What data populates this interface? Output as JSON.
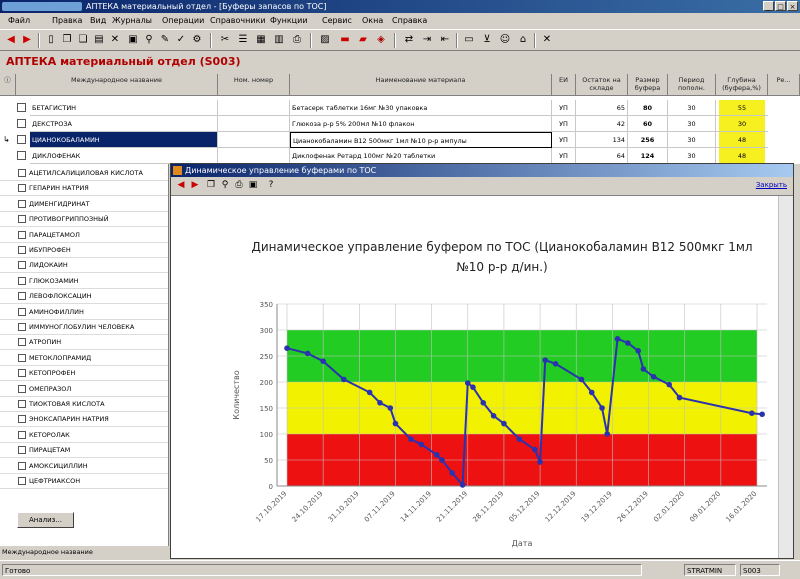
{
  "window": {
    "title": "АПТЕКА материальный отдел - [Буферы запасов по TOC]"
  },
  "menu": [
    "Файл",
    "Правка",
    "Вид",
    "Журналы",
    "Операции",
    "Справочники",
    "Функции",
    "Сервис",
    "Окна",
    "Справка"
  ],
  "header": {
    "title": "АПТЕКА материальный отдел (S003)"
  },
  "table": {
    "columns": [
      "Международное название",
      "Ном. номер",
      "Наименование материала",
      "ЕИ",
      "Остаток на складе",
      "Размер буфера",
      "Период пополн.",
      "Глубина (буфера,%)",
      "Ре..."
    ],
    "rows": [
      {
        "name": "БЕТАГИСТИН",
        "desc": "Бетасерк таблетки 16мг №30 упаковка",
        "unit": "УП",
        "stock": "65",
        "buffer": "80",
        "period": "30",
        "depth": "55",
        "highlight": false
      },
      {
        "name": "ДЕКСТРОЗА",
        "desc": "Глюкоза р-р 5% 200мл №10 флакон",
        "unit": "УП",
        "stock": "42",
        "buffer": "60",
        "period": "30",
        "depth": "30",
        "highlight": false
      },
      {
        "name": "ЦИАНОКОБАЛАМИН",
        "desc": "Цианокобаламин В12 500мкг 1мл №10 р-р ампулы",
        "unit": "УП",
        "stock": "134",
        "buffer": "256",
        "period": "30",
        "depth": "48",
        "highlight": true
      },
      {
        "name": "ДИКЛОФЕНАК",
        "desc": "Диклофенак Ретард 100мг №20 таблетки",
        "unit": "УП",
        "stock": "64",
        "buffer": "124",
        "period": "30",
        "depth": "48",
        "highlight": false
      }
    ]
  },
  "left_list": [
    "АЦЕТИЛСАЛИЦИЛОВАЯ КИСЛОТА",
    "ГЕПАРИН НАТРИЯ",
    "ДИМЕНГИДРИНАТ",
    "ПРОТИВОГРИППОЗНЫЙ",
    "ПАРАЦЕТАМОЛ",
    "ИБУПРОФЕН",
    "ЛИДОКАИН",
    "ГЛЮКОЗАМИН",
    "ЛЕВОФЛОКСАЦИН",
    "АМИНОФИЛЛИН",
    "ИММУНОГЛОБУЛИН ЧЕЛОВЕКА",
    "АТРОПИН",
    "МЕТОКЛОПРАМИД",
    "КЕТОПРОФЕН",
    "ОМЕПРАЗОЛ",
    "ТИОКТОВАЯ КИСЛОТА",
    "ЭНОКСАПАРИН НАТРИЯ",
    "КЕТОРОЛАК",
    "ПИРАЦЕТАМ",
    "АМОКСИЦИЛЛИН",
    "ЦЕФТРИАКСОН"
  ],
  "left_footer": {
    "button": "Анализ...",
    "status": "Международное название"
  },
  "popup": {
    "title": "Динамическое управление буферами по TOC",
    "close_link": "Закрыть"
  },
  "chart_data": {
    "type": "line",
    "title": "Динамическое управление буфером по TOC (Цианокобаламин В12 500мкг 1мл №10 р-р д/ин.)",
    "xlabel": "Дата",
    "ylabel": "Количество",
    "ylim": [
      0,
      350
    ],
    "yticks": [
      0,
      50,
      100,
      150,
      200,
      250,
      300,
      350
    ],
    "xticks": [
      "17.10.2019",
      "24.10.2019",
      "31.10.2019",
      "07.11.2019",
      "14.11.2019",
      "21.11.2019",
      "28.11.2019",
      "05.12.2019",
      "12.12.2019",
      "19.12.2019",
      "26.12.2019",
      "02.01.2020",
      "09.01.2020",
      "16.01.2020"
    ],
    "zones": [
      {
        "from": 0,
        "to": 100,
        "color": "#ee1111"
      },
      {
        "from": 100,
        "to": 200,
        "color": "#f2f200"
      },
      {
        "from": 200,
        "to": 300,
        "color": "#22cc22"
      }
    ],
    "grid": true,
    "points": [
      {
        "x": "17.10.2019",
        "y": 265
      },
      {
        "x": "21.10.2019",
        "y": 255
      },
      {
        "x": "24.10.2019",
        "y": 240
      },
      {
        "x": "28.10.2019",
        "y": 205
      },
      {
        "x": "02.11.2019",
        "y": 180
      },
      {
        "x": "04.11.2019",
        "y": 160
      },
      {
        "x": "06.11.2019",
        "y": 150
      },
      {
        "x": "07.11.2019",
        "y": 120
      },
      {
        "x": "10.11.2019",
        "y": 90
      },
      {
        "x": "12.11.2019",
        "y": 80
      },
      {
        "x": "15.11.2019",
        "y": 60
      },
      {
        "x": "16.11.2019",
        "y": 50
      },
      {
        "x": "18.11.2019",
        "y": 25
      },
      {
        "x": "20.11.2019",
        "y": 2
      },
      {
        "x": "21.11.2019",
        "y": 198
      },
      {
        "x": "22.11.2019",
        "y": 190
      },
      {
        "x": "24.11.2019",
        "y": 160
      },
      {
        "x": "26.11.2019",
        "y": 135
      },
      {
        "x": "28.11.2019",
        "y": 120
      },
      {
        "x": "01.12.2019",
        "y": 90
      },
      {
        "x": "04.12.2019",
        "y": 70
      },
      {
        "x": "05.12.2019",
        "y": 46
      },
      {
        "x": "06.12.2019",
        "y": 242
      },
      {
        "x": "08.12.2019",
        "y": 235
      },
      {
        "x": "13.12.2019",
        "y": 205
      },
      {
        "x": "15.12.2019",
        "y": 180
      },
      {
        "x": "17.12.2019",
        "y": 150
      },
      {
        "x": "18.12.2019",
        "y": 100
      },
      {
        "x": "20.12.2019",
        "y": 283
      },
      {
        "x": "22.12.2019",
        "y": 275
      },
      {
        "x": "24.12.2019",
        "y": 260
      },
      {
        "x": "25.12.2019",
        "y": 225
      },
      {
        "x": "27.12.2019",
        "y": 210
      },
      {
        "x": "30.12.2019",
        "y": 195
      },
      {
        "x": "01.01.2020",
        "y": 170
      },
      {
        "x": "15.01.2020",
        "y": 140
      },
      {
        "x": "17.01.2020",
        "y": 138
      }
    ]
  },
  "status": {
    "left": "Готово",
    "user": "STRATMIN",
    "code": "S003"
  },
  "colors": {
    "title_bar": "#0a246a",
    "header_text": "#b00000",
    "highlight": "#f6f020",
    "line": "#2a32b0"
  }
}
